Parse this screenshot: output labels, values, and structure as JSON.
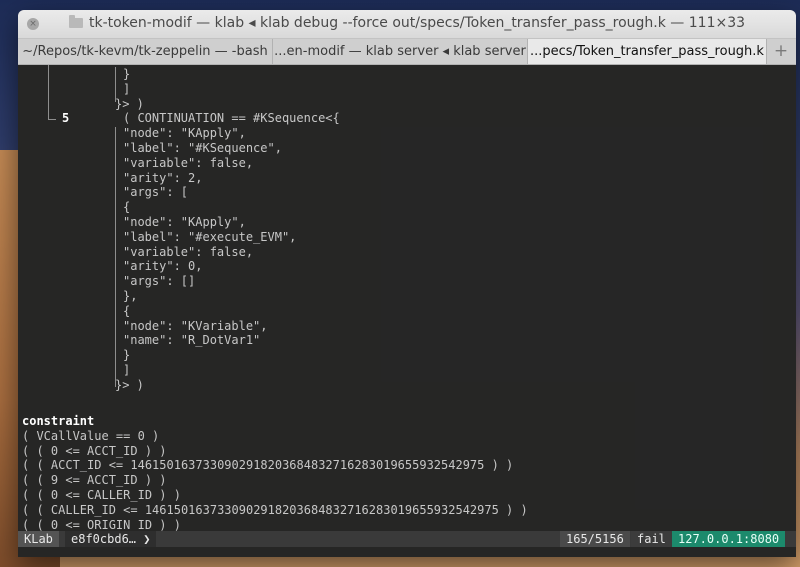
{
  "window": {
    "title": "tk-token-modif — klab ◂ klab debug --force out/specs/Token_transfer_pass_rough.k — 111×33",
    "close_glyph": "×"
  },
  "tabs": [
    {
      "label": "~/Repos/tk-kevm/tk-zeppelin — -bash"
    },
    {
      "label": "...en-modif — klab server ◂ klab server"
    },
    {
      "label": "...pecs/Token_transfer_pass_rough.k"
    }
  ],
  "tab_add": "+",
  "terminal": {
    "lines": [
      "}",
      "]",
      "}> )",
      "( CONTINUATION == #KSequence<{",
      "\"node\": \"KApply\",",
      "\"label\": \"#KSequence\",",
      "\"variable\": false,",
      "\"arity\": 2,",
      "\"args\": [",
      "{",
      "\"node\": \"KApply\",",
      "\"label\": \"#execute_EVM\",",
      "\"variable\": false,",
      "\"arity\": 0,",
      "\"args\": []",
      "},",
      "{",
      "\"node\": \"KVariable\",",
      "\"name\": \"R_DotVar1\"",
      "}",
      "]",
      "}> )"
    ],
    "line_number": "5",
    "constraint_label": "constraint",
    "constraints": [
      "( VCallValue == 0 )",
      "( ( 0 <= ACCT_ID ) )",
      "( ( ACCT_ID <= 1461501637330902918203684832716283019655932542975 ) )",
      "( ( 9 <= ACCT_ID ) )",
      "( ( 0 <= CALLER_ID ) )",
      "( ( CALLER_ID <= 1461501637330902918203684832716283019655932542975 ) )",
      "( ( 0 <= ORIGIN_ID ) )"
    ]
  },
  "statusbar": {
    "mode": "KLab",
    "hash": "e8f0cbd6… ❯",
    "count": "165/5156",
    "state": "fail",
    "address": "127.0.0.1:8080"
  }
}
